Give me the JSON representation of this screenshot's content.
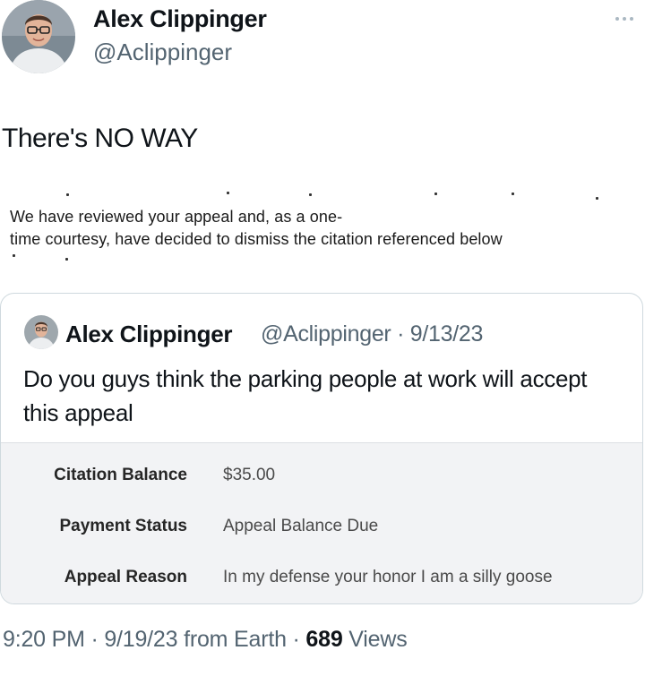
{
  "author": {
    "name": "Alex Clippinger",
    "handle": "@Aclippinger"
  },
  "tweet": {
    "text": "There's NO WAY"
  },
  "letter": {
    "line1": "We have reviewed your appeal and, as a one-",
    "line2": "time courtesy, have decided to dismiss the citation referenced below"
  },
  "quoted_tweet": {
    "name": "Alex Clippinger",
    "handle_date": "@Aclippinger · 9/13/23",
    "text": "Do you guys think the parking people at work will accept this appeal",
    "attachment": {
      "rows": [
        {
          "label": "Citation Balance",
          "value": "$35.00"
        },
        {
          "label": "Payment Status",
          "value": "Appeal Balance Due"
        },
        {
          "label": "Appeal Reason",
          "value": "In my defense your honor I am a silly goose"
        }
      ]
    }
  },
  "meta": {
    "time_date": "9:20 PM · 9/19/23 from Earth · ",
    "views_count": "689",
    "views_label": " Views"
  },
  "icons": {
    "more": "more-horizontal-icon"
  },
  "colors": {
    "text": "#0f1419",
    "secondary": "#536471",
    "border": "#cfd9de",
    "attachment_bg": "#f2f3f5"
  }
}
